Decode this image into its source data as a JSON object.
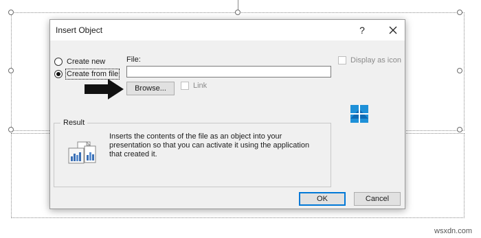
{
  "dialog": {
    "title": "Insert Object",
    "help_glyph": "?",
    "close_glyph": "✕"
  },
  "options": {
    "create_new_label": "Create new",
    "create_from_file_label": "Create from file",
    "selected": "create_from_file"
  },
  "file": {
    "label": "File:",
    "value": "",
    "browse_label": "Browse...",
    "link_label": "Link",
    "link_checked": false
  },
  "display_as_icon": {
    "label": "Display as icon",
    "checked": false
  },
  "result": {
    "legend": "Result",
    "text": "Inserts the contents of the file as an object into your presentation so that you can activate it using the application that created it."
  },
  "buttons": {
    "ok_label": "OK",
    "cancel_label": "Cancel"
  },
  "watermark": "wsxdn.com",
  "colors": {
    "dialog_bg": "#f0f0f0",
    "default_button_border": "#0078d7",
    "windows_logo": "#1e90d8"
  },
  "icons": [
    "help-icon",
    "close-icon",
    "arrow-right-icon",
    "document-chart-icon",
    "windows-logo-icon"
  ]
}
